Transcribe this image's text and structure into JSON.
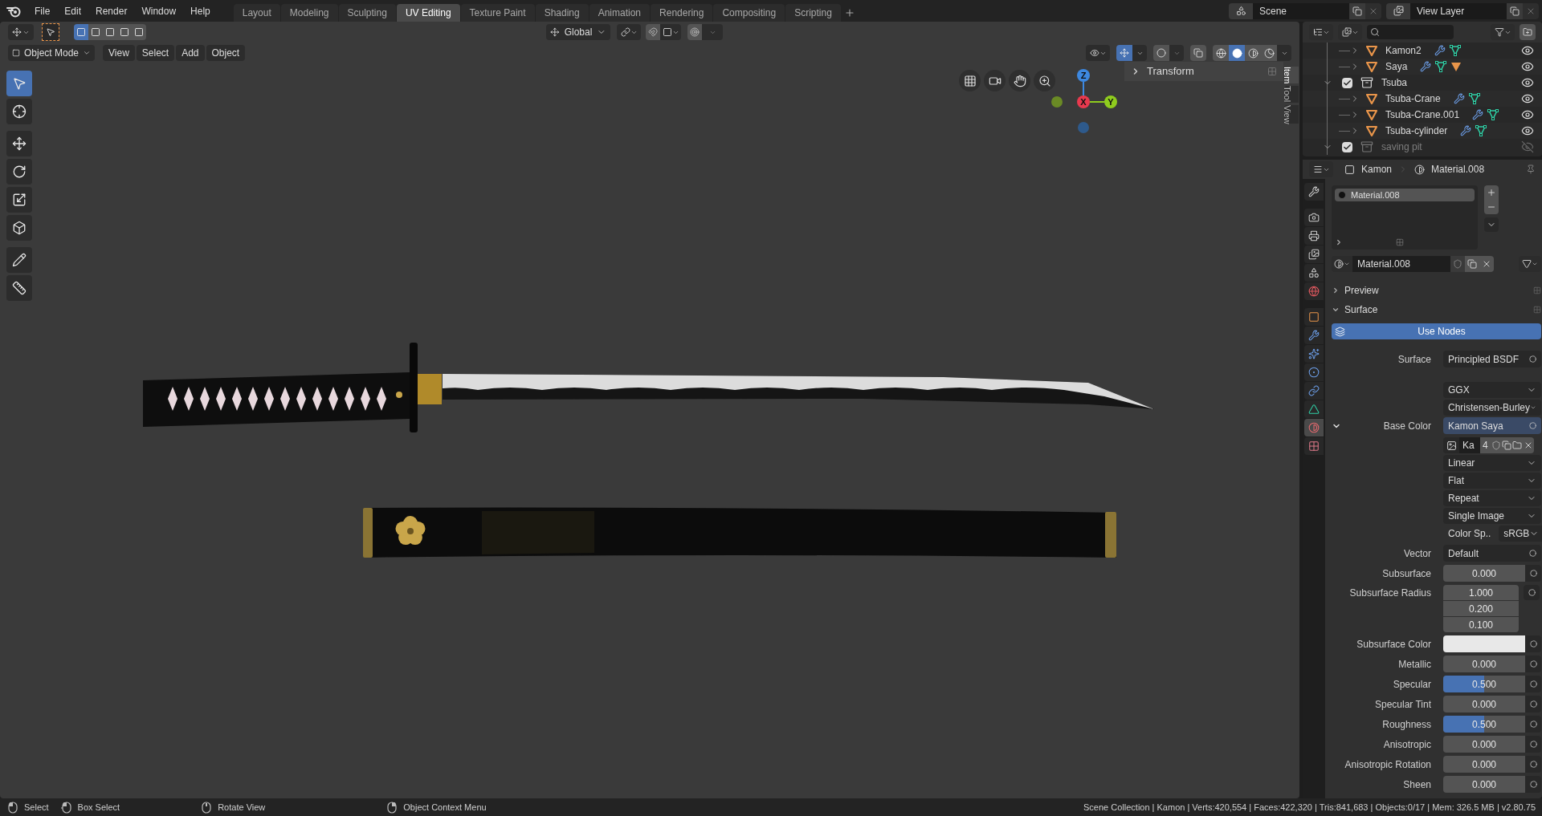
{
  "topbar": {
    "menus": [
      "File",
      "Edit",
      "Render",
      "Window",
      "Help"
    ],
    "workspaces": [
      {
        "label": "Layout",
        "selected": false
      },
      {
        "label": "Modeling",
        "selected": false
      },
      {
        "label": "Sculpting",
        "selected": false
      },
      {
        "label": "UV Editing",
        "selected": true
      },
      {
        "label": "Texture Paint",
        "selected": false
      },
      {
        "label": "Shading",
        "selected": false
      },
      {
        "label": "Animation",
        "selected": false
      },
      {
        "label": "Rendering",
        "selected": false
      },
      {
        "label": "Compositing",
        "selected": false
      },
      {
        "label": "Scripting",
        "selected": false
      }
    ],
    "scene": "Scene",
    "view_layer": "View Layer"
  },
  "viewport": {
    "select_modes": [
      {
        "selected": true
      },
      {
        "selected": false
      },
      {
        "selected": false
      },
      {
        "selected": false
      },
      {
        "selected": false
      }
    ],
    "transform_orientation": "Global",
    "mode": "Object Mode",
    "menus": [
      "View",
      "Select",
      "Add",
      "Object"
    ],
    "gizmos_on": true,
    "shading": [
      {
        "kind": "wireframe",
        "selected": false
      },
      {
        "kind": "solid",
        "selected": true
      },
      {
        "kind": "material",
        "selected": false
      },
      {
        "kind": "rendered",
        "selected": false
      }
    ],
    "tools": [
      {
        "kind": "select",
        "selected": true
      },
      {
        "kind": "cursor",
        "selected": false
      },
      {
        "kind": "move",
        "selected": false
      },
      {
        "kind": "rotate",
        "selected": false
      },
      {
        "kind": "scale",
        "selected": false
      },
      {
        "kind": "transform",
        "selected": false
      },
      {
        "kind": "annotate",
        "selected": false
      },
      {
        "kind": "measure",
        "selected": false
      }
    ],
    "axes": {
      "x": "X",
      "y": "Y",
      "z": "Z"
    },
    "sidebar": {
      "panel": "Transform",
      "panel_expanded": false,
      "tabs": [
        {
          "label": "Item",
          "selected": true
        },
        {
          "label": "Tool",
          "selected": false
        },
        {
          "label": "View",
          "selected": false
        }
      ]
    }
  },
  "outliner": {
    "rows": [
      {
        "kind": "object",
        "name": "Kamon2",
        "expanded": false,
        "material": false,
        "visible": true
      },
      {
        "kind": "object",
        "name": "Saya",
        "expanded": false,
        "material": true,
        "visible": true
      },
      {
        "kind": "collection",
        "name": "Tsuba",
        "checked": true,
        "expanded": true,
        "visible": true,
        "children": [
          {
            "kind": "object",
            "name": "Tsuba-Crane",
            "expanded": false,
            "material": false,
            "visible": true
          },
          {
            "kind": "object",
            "name": "Tsuba-Crane.001",
            "expanded": false,
            "material": false,
            "visible": true
          },
          {
            "kind": "object",
            "name": "Tsuba-cylinder",
            "expanded": false,
            "material": false,
            "visible": true
          }
        ]
      },
      {
        "kind": "collection",
        "name": "saving pit",
        "checked": true,
        "expanded": true,
        "visible": false
      }
    ]
  },
  "properties": {
    "object": "Kamon",
    "material": "Material.008",
    "tabs": [
      {
        "kind": "tool",
        "selected": false
      },
      {
        "kind": "render",
        "selected": false
      },
      {
        "kind": "output",
        "selected": false
      },
      {
        "kind": "view_layer",
        "selected": false
      },
      {
        "kind": "scene",
        "selected": false
      },
      {
        "kind": "world",
        "selected": false
      },
      {
        "kind": "object",
        "selected": false
      },
      {
        "kind": "modifiers",
        "selected": false
      },
      {
        "kind": "particles",
        "selected": false
      },
      {
        "kind": "physics",
        "selected": false
      },
      {
        "kind": "constraints",
        "selected": false
      },
      {
        "kind": "data",
        "selected": false
      },
      {
        "kind": "material",
        "selected": true
      },
      {
        "kind": "texture",
        "selected": false
      }
    ],
    "slots": [
      {
        "name": "Material.008",
        "selected": true
      }
    ],
    "datablock": "Material.008",
    "panels": [
      {
        "label": "Preview",
        "expanded": false
      },
      {
        "label": "Surface",
        "expanded": true
      }
    ],
    "use_nodes": {
      "label": "Use Nodes",
      "on": true
    },
    "rows": [
      {
        "kind": "socket",
        "label": "Surface",
        "value": "Principled BSDF"
      },
      {
        "kind": "dropdown",
        "value": "GGX"
      },
      {
        "kind": "dropdown",
        "value": "Christensen-Burley"
      },
      {
        "kind": "socket",
        "label": "Base Color",
        "value": "Kamon Saya",
        "expanded": true
      },
      {
        "kind": "image",
        "name": "Ka",
        "users": "4"
      },
      {
        "kind": "dropdown",
        "value": "Linear"
      },
      {
        "kind": "dropdown",
        "value": "Flat"
      },
      {
        "kind": "dropdown",
        "value": "Repeat"
      },
      {
        "kind": "dropdown",
        "value": "Single Image"
      },
      {
        "kind": "colorspace",
        "label": "Color Sp..",
        "value": "sRGB"
      },
      {
        "kind": "socket",
        "label": "Vector",
        "value": "Default"
      },
      {
        "kind": "number",
        "label": "Subsurface",
        "value": "0.000",
        "level": 0
      },
      {
        "kind": "vector",
        "label": "Subsurface Radius",
        "values": [
          "1.000",
          "0.200",
          "0.100"
        ]
      },
      {
        "kind": "color",
        "label": "Subsurface Color",
        "color": "#e8e8e8"
      },
      {
        "kind": "number",
        "label": "Metallic",
        "value": "0.000",
        "level": 0
      },
      {
        "kind": "number",
        "label": "Specular",
        "value": "0.500",
        "level": 0.5
      },
      {
        "kind": "number",
        "label": "Specular Tint",
        "value": "0.000",
        "level": 0
      },
      {
        "kind": "number",
        "label": "Roughness",
        "value": "0.500",
        "level": 0.5
      },
      {
        "kind": "number",
        "label": "Anisotropic",
        "value": "0.000",
        "level": 0
      },
      {
        "kind": "number",
        "label": "Anisotropic Rotation",
        "value": "0.000",
        "level": 0
      },
      {
        "kind": "number",
        "label": "Sheen",
        "value": "0.000",
        "level": 0
      }
    ]
  },
  "status_bar": {
    "hints": [
      {
        "kind": "click",
        "label": "Select"
      },
      {
        "kind": "drag",
        "label": "Box Select"
      },
      {
        "kind": "middle",
        "label": "Rotate View"
      },
      {
        "kind": "right",
        "label": "Object Context Menu"
      }
    ],
    "stats": "Scene Collection | Kamon | Verts:420,554 | Faces:422,320 | Tris:841,683 | Objects:0/17 | Mem: 326.5 MB | v2.80.75"
  }
}
